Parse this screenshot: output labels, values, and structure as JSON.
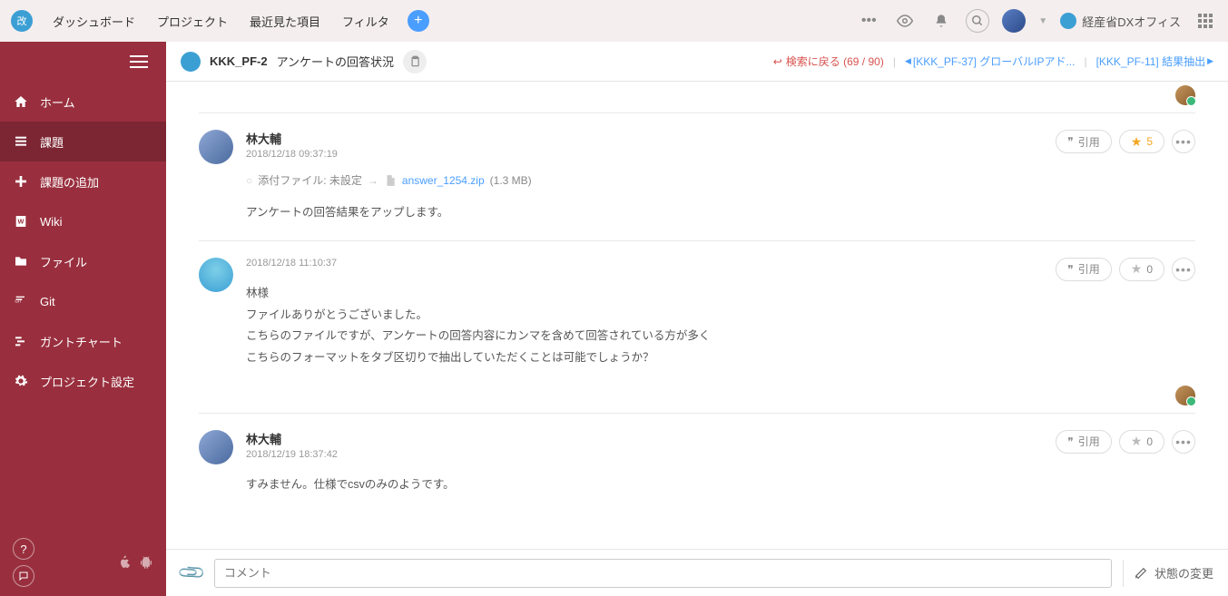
{
  "topnav": {
    "items": [
      "ダッシュボード",
      "プロジェクト",
      "最近見た項目",
      "フィルタ"
    ]
  },
  "org": {
    "name": "経産省DXオフィス"
  },
  "sidebar": {
    "items": [
      {
        "label": "ホーム"
      },
      {
        "label": "課題"
      },
      {
        "label": "課題の追加"
      },
      {
        "label": "Wiki"
      },
      {
        "label": "ファイル"
      },
      {
        "label": "Git"
      },
      {
        "label": "ガントチャート"
      },
      {
        "label": "プロジェクト設定"
      }
    ]
  },
  "issue": {
    "key": "KKK_PF-2",
    "title": "アンケートの回答状況",
    "back_search": "検索に戻る (69 / 90)",
    "prev_link": "[KKK_PF-37] グローバルIPアド...",
    "next_link": "[KKK_PF-11] 結果抽出"
  },
  "comments": [
    {
      "author": "林大輔",
      "time": "2018/12/18 09:37:19",
      "attach_label": "添付ファイル: 未設定",
      "attach_file": "answer_1254.zip",
      "attach_size": "(1.3 MB)",
      "body": "アンケートの回答結果をアップします。",
      "star_count": "5",
      "star_active": true,
      "quote": "引用"
    },
    {
      "author": "",
      "time": "2018/12/18 11:10:37",
      "body_lines": [
        "林様",
        "",
        "ファイルありがとうございました。",
        "こちらのファイルですが、アンケートの回答内容にカンマを含めて回答されている方が多く",
        "こちらのフォーマットをタブ区切りで抽出していただくことは可能でしょうか？"
      ],
      "star_count": "0",
      "quote": "引用"
    },
    {
      "author": "林大輔",
      "time": "2018/12/19 18:37:42",
      "body": "すみません。仕様でcsvのみのようです。",
      "star_count": "0",
      "quote": "引用"
    }
  ],
  "footer": {
    "placeholder": "コメント",
    "status_change": "状態の変更"
  }
}
